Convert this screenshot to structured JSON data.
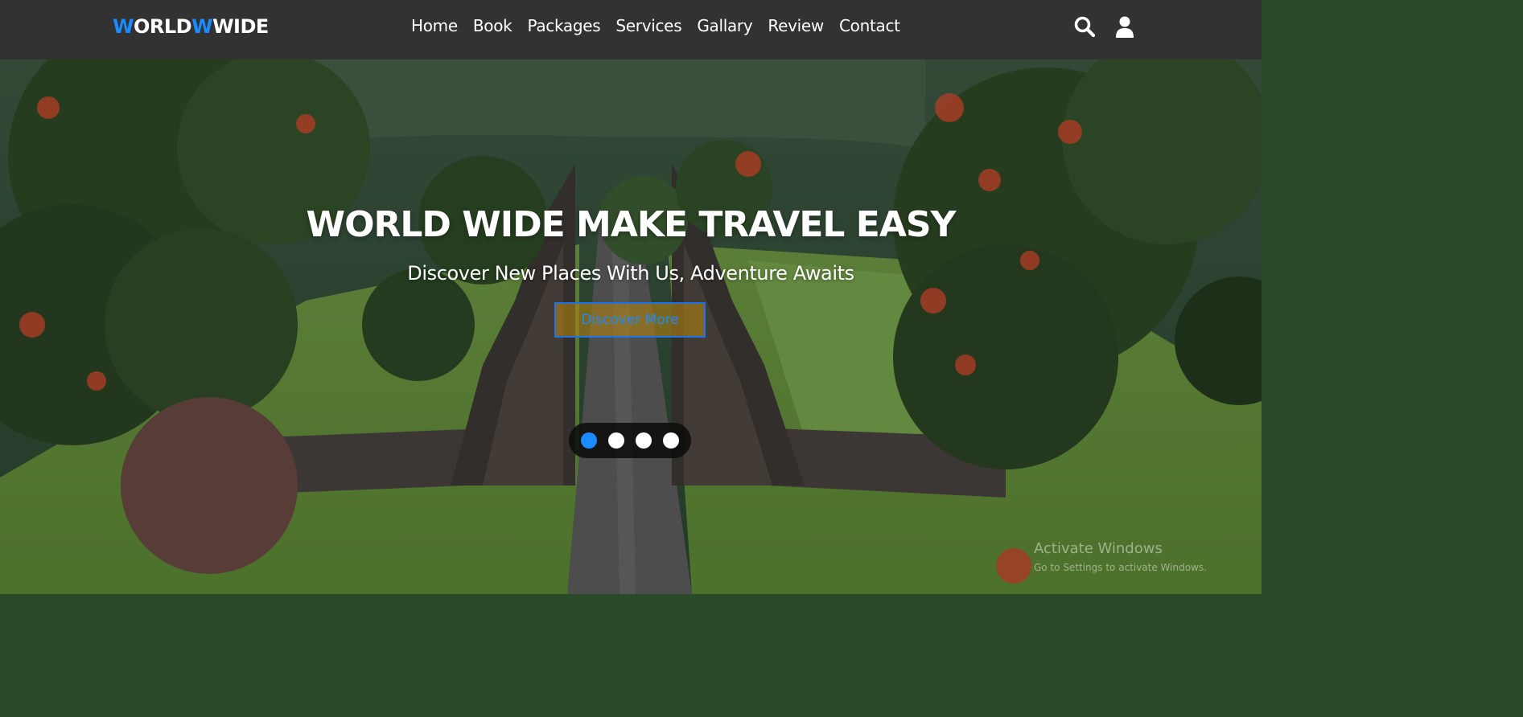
{
  "navbar": {
    "logo": {
      "first_letter": "W",
      "part1": "ORLD",
      "second_letter": "W",
      "part2": "WIDE"
    },
    "links": [
      "Home",
      "Book",
      "Packages",
      "Services",
      "Gallary",
      "Review",
      "Contact"
    ],
    "icons": [
      "search-icon",
      "user-icon"
    ]
  },
  "hero": {
    "title": "WORLD WIDE MAKE TRAVEL EASY",
    "subtitle": "Discover New Places With Us, Adventure Awaits",
    "button_label": "Discover More",
    "slider": {
      "count": 4,
      "active_index": 0
    }
  },
  "watermark": {
    "title": "Activate Windows",
    "subtitle": "Go to Settings to activate Windows."
  },
  "colors": {
    "navbar_bg": "#323232",
    "accent": "#1a8cff",
    "button_fill": "#b08214"
  }
}
